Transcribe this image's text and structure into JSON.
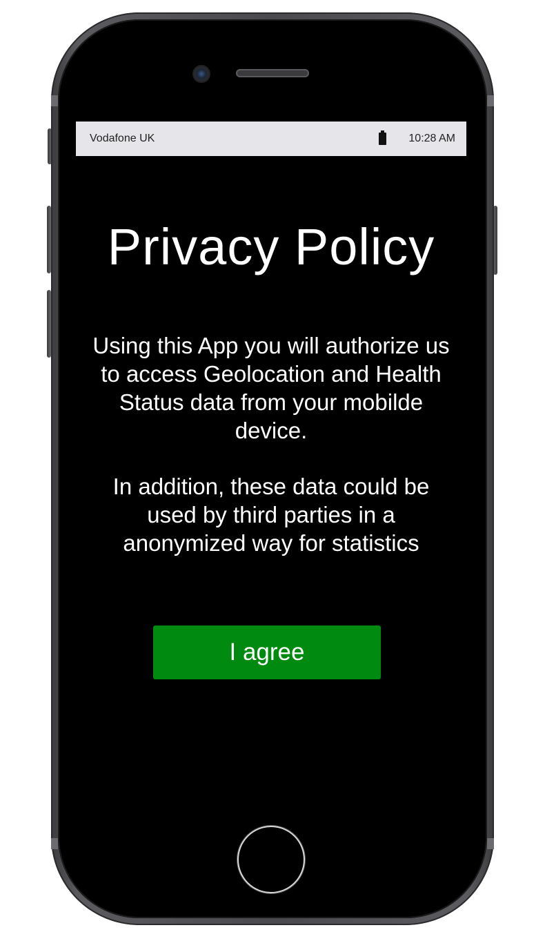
{
  "status_bar": {
    "carrier": "Vodafone UK",
    "time": "10:28 AM",
    "battery_icon": "battery-icon"
  },
  "screen": {
    "title": "Privacy Policy",
    "paragraph_1": "Using this App you will authorize us to access Geolocation and Health Status data from your mobilde device.",
    "paragraph_2": "In addition, these data could be used by third parties in a anonymized way for statistics",
    "agree_button": "I agree"
  },
  "colors": {
    "screen_background": "#000000",
    "status_bar_background": "#e6e6ea",
    "agree_button_background": "#008a10",
    "text": "#ffffff"
  }
}
